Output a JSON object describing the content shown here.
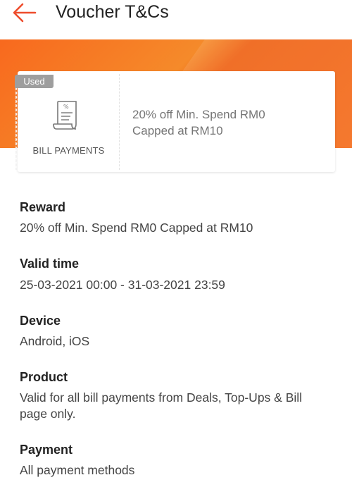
{
  "header": {
    "title": "Voucher T&Cs",
    "back_icon": "arrow-left-icon",
    "accent_color": "#ee4d2d"
  },
  "voucher": {
    "status_badge": "Used",
    "category_icon": "bill-receipt-icon",
    "category_label": "BILL PAYMENTS",
    "description_line1": "20% off Min. Spend RM0",
    "description_line2": "Capped at RM10",
    "banner_color": "#f46a18"
  },
  "details": {
    "reward": {
      "label": "Reward",
      "value": "20% off Min. Spend RM0 Capped at RM10"
    },
    "valid_time": {
      "label": "Valid time",
      "value": "25-03-2021 00:00 - 31-03-2021 23:59"
    },
    "device": {
      "label": "Device",
      "value": "Android, iOS"
    },
    "product": {
      "label": "Product",
      "value_line1": "Valid for all bill payments from Deals, Top-Ups & Bill",
      "value_line2": "page only."
    },
    "payment": {
      "label": "Payment",
      "value": "All payment methods"
    }
  }
}
